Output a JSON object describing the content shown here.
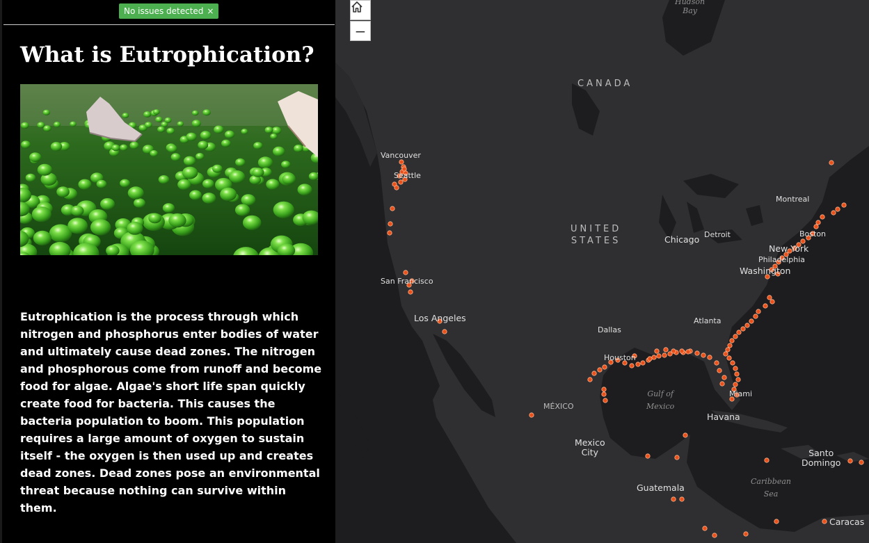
{
  "notice": {
    "text": "No issues detected",
    "close": "×"
  },
  "story": {
    "title": "What is Eutrophication?",
    "body": "Eutrophication is the process through which nitrogen and phosphorus enter bodies of water and ultimately cause dead zones. The nitrogen and phosphorous come from runoff and become food for algae. Algae's short life span quickly create food for bacteria. This causes the bacteria population to boom. This population requires a large amount of oxygen to sustain itself - the oxygen is then used up and creates dead zones. Dead zones pose an environmental threat because nothing can survive within them."
  },
  "map": {
    "zoom_out_label": "−",
    "home_icon": "home-icon",
    "marker_color": "#e8501c",
    "labels": {
      "hudson1": "Hudson",
      "hudson2": "Bay",
      "canada": "CANADA",
      "us1": "UNITED",
      "us2": "STATES",
      "mexico_country": "MÉXICO",
      "vancouver": "Vancouver",
      "seattle": "Seattle",
      "san_francisco": "San Francisco",
      "los_angeles": "Los Angeles",
      "chicago": "Chicago",
      "detroit": "Detroit",
      "montreal": "Montreal",
      "boston": "Boston",
      "new_york": "New York",
      "philadelphia": "Philadelphia",
      "washington": "Washington",
      "atlanta": "Atlanta",
      "dallas": "Dallas",
      "houston": "Houston",
      "miami": "Miami",
      "havana": "Havana",
      "gulf1": "Gulf of",
      "gulf2": "Mexico",
      "mexico_city1": "Mexico",
      "mexico_city2": "City",
      "guatemala": "Guatemala",
      "santo1": "Santo",
      "santo2": "Domingo",
      "caribbean1": "Caribbean",
      "caribbean2": "Sea",
      "caracas": "Caracas"
    }
  }
}
